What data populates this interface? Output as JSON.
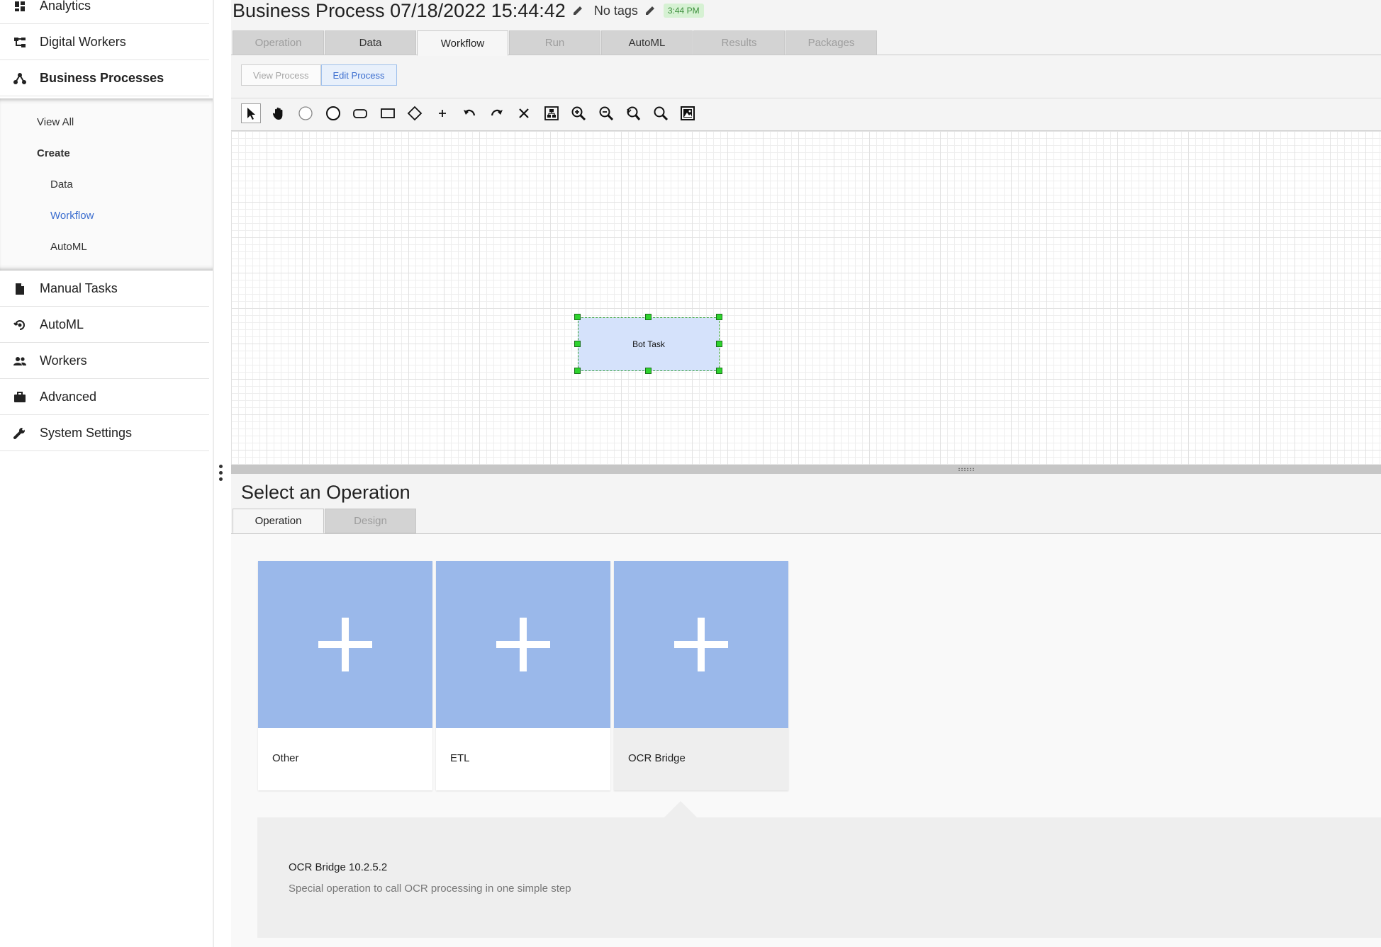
{
  "sidebar": {
    "items": [
      {
        "label": "Analytics",
        "icon": "dashboard-icon"
      },
      {
        "label": "Digital Workers",
        "icon": "hierarchy-icon"
      },
      {
        "label": "Business Processes",
        "icon": "process-icon"
      },
      {
        "label": "Manual Tasks",
        "icon": "document-icon"
      },
      {
        "label": "AutoML",
        "icon": "automl-icon"
      },
      {
        "label": "Workers",
        "icon": "people-icon"
      },
      {
        "label": "Advanced",
        "icon": "briefcase-icon"
      },
      {
        "label": "System Settings",
        "icon": "wrench-icon"
      }
    ],
    "submenu": {
      "view_all": "View All",
      "create": "Create",
      "data": "Data",
      "workflow": "Workflow",
      "automl": "AutoML"
    }
  },
  "header": {
    "title": "Business Process 07/18/2022 15:44:42",
    "tags": "No tags",
    "time_badge": "3:44 PM"
  },
  "tabs": [
    "Operation",
    "Data",
    "Workflow",
    "Run",
    "AutoML",
    "Results",
    "Packages"
  ],
  "active_tab": "Workflow",
  "mode": {
    "view": "View Process",
    "edit": "Edit Process",
    "selected": "Edit Process"
  },
  "toolbar": [
    "pointer-icon",
    "hand-icon",
    "start-event-icon",
    "end-event-icon",
    "task-icon",
    "subprocess-icon",
    "gateway-icon",
    "add-icon",
    "undo-icon",
    "redo-icon",
    "delete-icon",
    "fit-icon",
    "zoom-in-icon",
    "zoom-out-icon",
    "zoom-reset-icon",
    "zoom-icon",
    "export-image-icon"
  ],
  "canvas": {
    "task_label": "Bot Task"
  },
  "operations": {
    "title": "Select an Operation",
    "tabs": [
      "Operation",
      "Design"
    ],
    "cards": [
      {
        "name": "Other"
      },
      {
        "name": "ETL"
      },
      {
        "name": "OCR Bridge"
      }
    ],
    "selected": "OCR Bridge",
    "detail": {
      "title": "OCR Bridge 10.2.5.2",
      "description": "Special operation to call OCR processing in one simple step"
    }
  },
  "colors": {
    "accent": "#3c6ecf",
    "tile": "#9ab8ea",
    "task_fill": "#d5e2fb",
    "handle": "#2ed32e",
    "badge": "#d6f1d3"
  }
}
